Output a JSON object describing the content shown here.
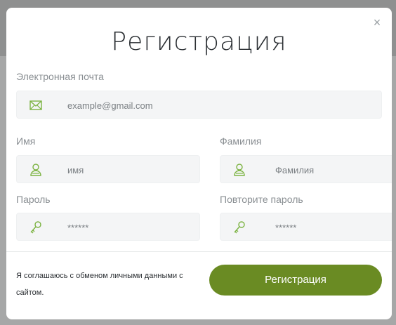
{
  "title": "Регистрация",
  "close_symbol": "×",
  "fields": {
    "email": {
      "label": "Электронная почта",
      "placeholder": "example@gmail.com",
      "icon": "envelope-icon"
    },
    "first_name": {
      "label": "Имя",
      "placeholder": "имя",
      "icon": "user-icon"
    },
    "last_name": {
      "label": "Фамилия",
      "placeholder": "Фамилия",
      "icon": "user-icon"
    },
    "password": {
      "label": "Пароль",
      "placeholder": "******",
      "icon": "key-icon"
    },
    "password_repeat": {
      "label": "Повторите пароль",
      "placeholder": "******",
      "icon": "key-icon"
    }
  },
  "agreement_text": "Я соглашаюсь с обменом личными данными с сайтом.",
  "submit_label": "Регистрация",
  "colors": {
    "accent": "#6a8b23",
    "icon": "#7cb342",
    "field_bg": "#f4f5f6"
  }
}
